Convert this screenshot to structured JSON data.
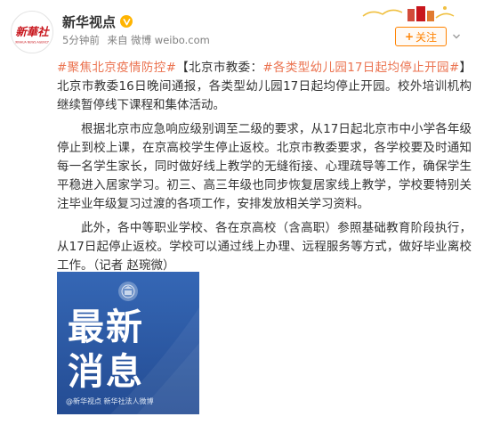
{
  "post": {
    "avatar": {
      "text": "新華社",
      "alt_caption": "XINHUA NEWS AGENCY"
    },
    "author": "新华视点",
    "verified_badge_icon": "verified-badge-icon",
    "meta": {
      "time": "5分钟前",
      "source": "来自 微博 weibo.com"
    },
    "follow": {
      "plus": "+",
      "label": "关注"
    },
    "body": {
      "hashtag1": "#聚焦北京疫情防控#",
      "headline_lead": "【北京市教委：",
      "hashtag2": "#各类型幼儿园17日起均停止开园#",
      "headline_tail": "】北京市教委16日晚间通报，各类型幼儿园17日起均停止开园。校外培训机构继续暂停线下课程和集体活动。",
      "para2": "根据北京市应急响应级别调至二级的要求，从17日起北京市中小学各年级停止到校上课，在京高校学生停止返校。北京市教委要求，各学校要及时通知每一名学生家长，同时做好线上教学的无缝衔接、心理疏导等工作，确保学生平稳进入居家学习。初三、高三年级也同步恢复居家线上教学，学校要特别关注毕业年级复习过渡的各项工作，安排发放相关学习资料。",
      "para3": "此外，各中等职业学校、各在京高校（含高职）参照基础教育阶段执行，从17日起停止返校。学校可以通过线上办理、远程服务等方式，做好毕业离校工作。（记者 赵琬微）"
    },
    "image": {
      "line1": "最新",
      "line2": "消息",
      "footer": "@新华视点  新华社法人微博"
    },
    "colors": {
      "accent_orange": "#ff8200",
      "link": "#eb7350",
      "image_blue": "#2d5aa6",
      "verified_yellow": "#ffb400",
      "logo_red": "#c8161d"
    }
  }
}
